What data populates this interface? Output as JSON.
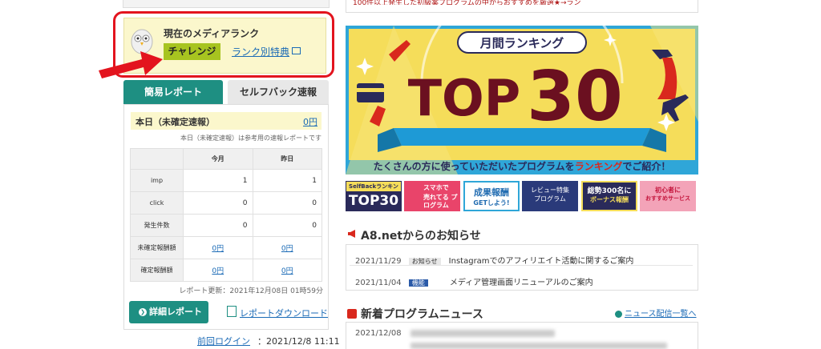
{
  "left": {
    "rank": {
      "title": "現在のメディアランク",
      "badge": "チャレンジ",
      "link": "ランク別特典"
    },
    "tabs": [
      "簡易レポート",
      "セルフバック速報"
    ],
    "today": {
      "label": "本日（未確定速報）",
      "value": "0円",
      "note": "本日（未確定速報）は参考用の速報レポートです"
    },
    "table": {
      "headers": [
        "今月",
        "昨日"
      ],
      "rows": [
        {
          "label": "imp",
          "month": "1",
          "yesterday": "1"
        },
        {
          "label": "click",
          "month": "0",
          "yesterday": "0"
        },
        {
          "label": "発生件数",
          "month": "0",
          "yesterday": "0"
        },
        {
          "label": "未確定報酬額",
          "month": "0円",
          "yesterday": "0円"
        },
        {
          "label": "確定報酬額",
          "month": "0円",
          "yesterday": "0円"
        }
      ]
    },
    "updated": "レポート更新：2021年12月08日 01時59分",
    "detail_button": "詳細レポート",
    "download_link": "レポートダウンロード",
    "last_login_label": "前回ログイン",
    "last_login_value": "：2021/12/8 11:11"
  },
  "right": {
    "top_text": "100件以上発生した初級案プログラムの中からおすすめを厳選★→ラン",
    "banner": {
      "ribbon": "月間ランキング",
      "headline_left": "TOP",
      "headline_right": "30",
      "caption_a": "たくさんの方に使っていただいたプログラムを",
      "caption_b": "ランキング",
      "caption_c": "でご紹介！"
    },
    "mini_banners": [
      {
        "top": "SelfBackランキング",
        "main": "TOP30"
      },
      {
        "top": "スマホで",
        "main": "売れてる プログラム"
      },
      {
        "top": "成果報酬",
        "main": "GETしよう!"
      },
      {
        "top": "レビュー特集",
        "main": "プログラム"
      },
      {
        "top": "総勢300名に",
        "main": "ボーナス報酬"
      },
      {
        "top": "初心者に",
        "main": "おすすめサービス"
      }
    ],
    "notice_heading": "A8.netからのお知らせ",
    "notices": [
      {
        "date": "2021/11/29",
        "tag": "お知らせ",
        "text": "Instagramでのアフィリエイト活動に関するご案内"
      },
      {
        "date": "2021/11/04",
        "tag": "機能",
        "text": "メディア管理画面リニューアルのご案内"
      }
    ],
    "program_heading": "新着プログラムニュース",
    "program_link": "ニュース配信一覧へ",
    "program_date": "2021/12/08"
  },
  "colors": {
    "teal": "#1e8f82",
    "yellow_bg": "#fbf7cc",
    "highlight_red": "#e3141e",
    "link_blue": "#1a6ab6",
    "badge_green": "#a7c420",
    "banner_navy": "#2a2a5a",
    "banner_yellow": "#f5dd5a"
  }
}
